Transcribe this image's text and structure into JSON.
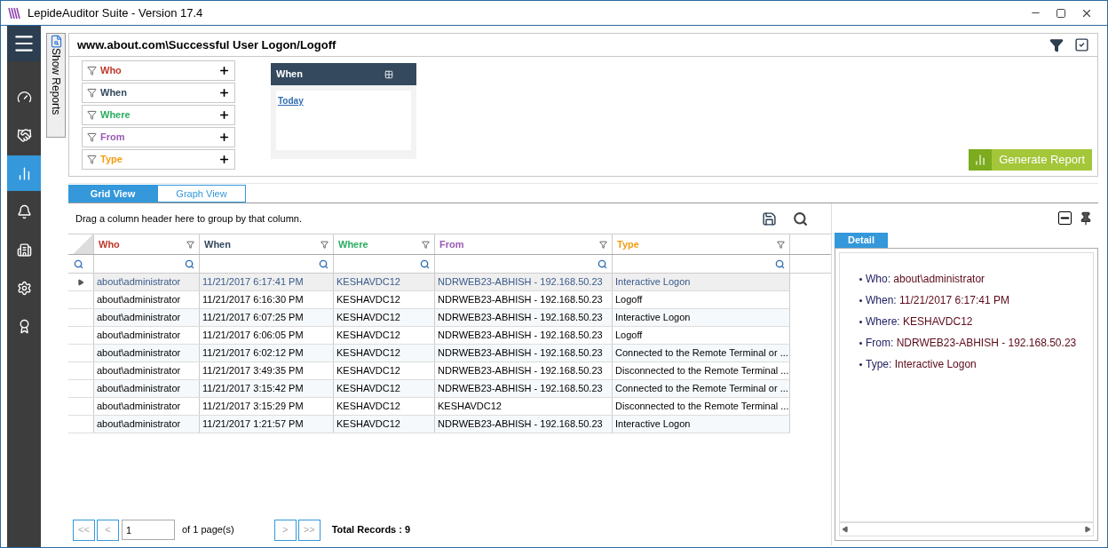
{
  "window": {
    "title": "LepideAuditor Suite - Version 17.4"
  },
  "sidebar": {
    "items": [
      {
        "kind": "gauge",
        "selected": false
      },
      {
        "kind": "hand",
        "selected": false
      },
      {
        "kind": "analytics",
        "selected": true
      },
      {
        "kind": "bell",
        "selected": false
      },
      {
        "kind": "building",
        "selected": false
      },
      {
        "kind": "gear",
        "selected": false
      },
      {
        "kind": "award",
        "selected": false
      }
    ]
  },
  "show_reports": "Show Reports",
  "report": {
    "title": "www.about.com\\Successful User Logon/Logoff",
    "filters": [
      {
        "label": "Who",
        "color": "#c0392b"
      },
      {
        "label": "When",
        "color": "#34495e"
      },
      {
        "label": "Where",
        "color": "#27ae60"
      },
      {
        "label": "From",
        "color": "#9b59b6"
      },
      {
        "label": "Type",
        "color": "#f39c12"
      }
    ],
    "when_panel": {
      "title": "When",
      "link": "Today"
    },
    "generate_button": "Generate Report"
  },
  "tabs": [
    {
      "label": "Grid View",
      "selected": true
    },
    {
      "label": "Graph View",
      "selected": false
    }
  ],
  "group_hint": "Drag a column header here to group by that column.",
  "table": {
    "columns": [
      {
        "label": "Who",
        "color": "#c0392b"
      },
      {
        "label": "When",
        "color": "#34495e"
      },
      {
        "label": "Where",
        "color": "#27ae60"
      },
      {
        "label": "From",
        "color": "#9b59b6"
      },
      {
        "label": "Type",
        "color": "#f39c12"
      }
    ],
    "rows": [
      {
        "selected": true,
        "cells": [
          "about\\administrator",
          "11/21/2017 6:17:41 PM",
          "KESHAVDC12",
          "NDRWEB23-ABHISH - 192.168.50.23",
          "Interactive Logon"
        ]
      },
      {
        "selected": false,
        "cells": [
          "about\\administrator",
          "11/21/2017 6:16:30 PM",
          "KESHAVDC12",
          "NDRWEB23-ABHISH - 192.168.50.23",
          "Logoff"
        ]
      },
      {
        "selected": false,
        "cells": [
          "about\\administrator",
          "11/21/2017 6:07:25 PM",
          "KESHAVDC12",
          "NDRWEB23-ABHISH - 192.168.50.23",
          "Interactive Logon"
        ]
      },
      {
        "selected": false,
        "cells": [
          "about\\administrator",
          "11/21/2017 6:06:05 PM",
          "KESHAVDC12",
          "NDRWEB23-ABHISH - 192.168.50.23",
          "Logoff"
        ]
      },
      {
        "selected": false,
        "cells": [
          "about\\administrator",
          "11/21/2017 6:02:12 PM",
          "KESHAVDC12",
          "NDRWEB23-ABHISH - 192.168.50.23",
          "Connected to the Remote Terminal or ..."
        ]
      },
      {
        "selected": false,
        "cells": [
          "about\\administrator",
          "11/21/2017 3:49:35 PM",
          "KESHAVDC12",
          "NDRWEB23-ABHISH - 192.168.50.23",
          "Disconnected to the Remote Terminal ..."
        ]
      },
      {
        "selected": false,
        "cells": [
          "about\\administrator",
          "11/21/2017 3:15:42 PM",
          "KESHAVDC12",
          "NDRWEB23-ABHISH - 192.168.50.23",
          "Connected to the Remote Terminal or ..."
        ]
      },
      {
        "selected": false,
        "cells": [
          "about\\administrator",
          "11/21/2017 3:15:29 PM",
          "KESHAVDC12",
          "KESHAVDC12",
          "Disconnected to the Remote Terminal ..."
        ]
      },
      {
        "selected": false,
        "cells": [
          "about\\administrator",
          "11/21/2017 1:21:57 PM",
          "KESHAVDC12",
          "NDRWEB23-ABHISH - 192.168.50.23",
          "Interactive Logon"
        ]
      }
    ]
  },
  "pagination": {
    "first": "<<",
    "prev": "<",
    "page": "1",
    "of_pages": "of 1 page(s)",
    "next": ">",
    "last": ">>",
    "total": "Total Records : 9"
  },
  "detail": {
    "tab": "Detail",
    "items": [
      {
        "label": "Who:",
        "value": "about\\administrator"
      },
      {
        "label": "When:",
        "value": "11/21/2017 6:17:41 PM"
      },
      {
        "label": "Where:",
        "value": "KESHAVDC12"
      },
      {
        "label": "From:",
        "value": "NDRWEB23-ABHISH - 192.168.50.23"
      },
      {
        "label": "Type:",
        "value": "Interactive Logon"
      }
    ]
  }
}
